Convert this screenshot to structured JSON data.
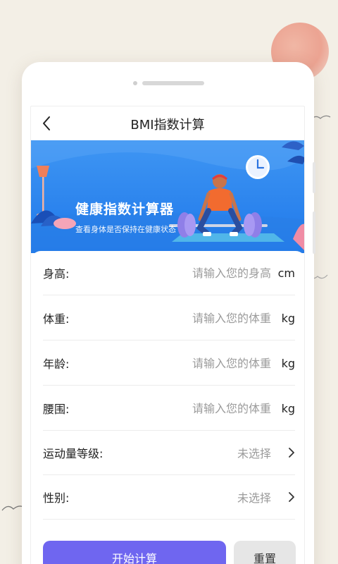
{
  "nav": {
    "title": "BMI指数计算"
  },
  "banner": {
    "title": "健康指数计算器",
    "subtitle": "查看身体是否保持在健康状态"
  },
  "form": {
    "height": {
      "label": "身高:",
      "placeholder": "请输入您的身高",
      "unit": "cm"
    },
    "weight": {
      "label": "体重:",
      "placeholder": "请输入您的体重",
      "unit": "kg"
    },
    "age": {
      "label": "年龄:",
      "placeholder": "请输入您的体重",
      "unit": "kg"
    },
    "waist": {
      "label": "腰围:",
      "placeholder": "请输入您的体重",
      "unit": "kg"
    },
    "exercise": {
      "label": "运动量等级:",
      "value": "未选择"
    },
    "gender": {
      "label": "性别:",
      "value": "未选择"
    }
  },
  "buttons": {
    "calculate": "开始计算",
    "reset": "重置"
  },
  "colors": {
    "accent": "#6f66f0",
    "banner_blue": "#2f86f0",
    "background": "#f3efe6"
  }
}
